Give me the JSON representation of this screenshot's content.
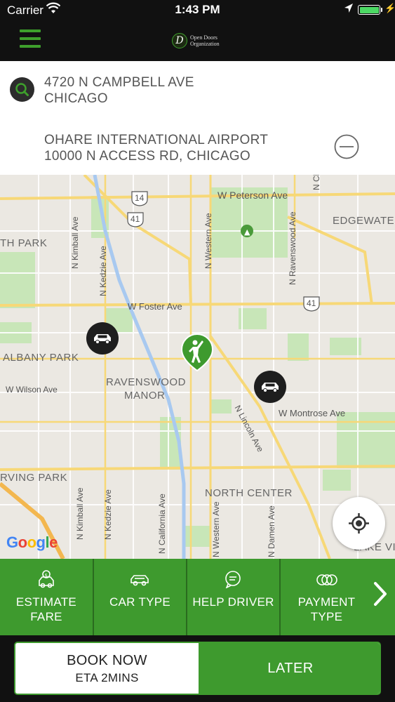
{
  "status_bar": {
    "carrier": "Carrier",
    "time": "1:43 PM"
  },
  "header": {
    "logo_letter": "D",
    "logo_line1": "Open Doors",
    "logo_line2": "Organization"
  },
  "pickup": {
    "line1": "4720 N CAMPBELL AVE",
    "line2": "CHICAGO"
  },
  "destination": {
    "line1": "OHARE INTERNATIONAL AIRPORT",
    "line2": "10000 N ACCESS RD, CHICAGO"
  },
  "map": {
    "labels": {
      "peterson": "W Peterson Ave",
      "foster": "W Foster Ave",
      "wilson": "W Wilson Ave",
      "montrose": "W Montrose Ave",
      "edgewater": "EDGEWATER",
      "th_park": "TH PARK",
      "albany_park": "ALBANY PARK",
      "ravenswood_1": "RAVENSWOOD",
      "ravenswood_2": "MANOR",
      "irving_park": "RVING PARK",
      "north_center": "NORTH CENTER",
      "lake_view": "LAKE VI",
      "kimball_top": "N Kimball Ave",
      "kedzie_top": "N Kedzie Ave",
      "western_top": "N Western Ave",
      "ravenswood_ave": "N Ravenswood Ave",
      "lincoln": "N Lincoln Ave",
      "kimball_bot": "N Kimball Ave",
      "kedzie_bot": "N Kedzie Ave",
      "california": "N California Ave",
      "western_bot": "N Western Ave",
      "damen": "N Damen Ave",
      "clark_partial": "N Cl",
      "route_14": "14",
      "route_41a": "41",
      "route_41b": "41"
    },
    "attribution": "Google"
  },
  "actions": [
    {
      "label_1": "ESTIMATE",
      "label_2": "FARE",
      "icon": "estimate-fare-icon"
    },
    {
      "label_1": "CAR TYPE",
      "label_2": "",
      "icon": "car-type-icon"
    },
    {
      "label_1": "HELP DRIVER",
      "label_2": "",
      "icon": "help-driver-icon"
    },
    {
      "label_1": "PAYMENT",
      "label_2": "TYPE",
      "icon": "payment-type-icon"
    }
  ],
  "booking": {
    "book_now": "BOOK NOW",
    "eta": "ETA 2MINS",
    "later": "LATER"
  },
  "colors": {
    "brand_green": "#3e9a2e",
    "header_black": "#111111"
  }
}
